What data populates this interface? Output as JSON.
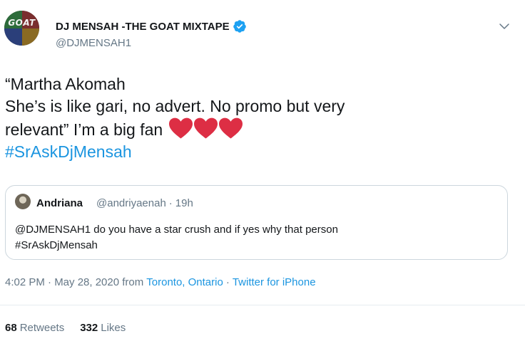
{
  "author": {
    "avatar_text": "GOAT",
    "name": "DJ MENSAH -THE GOAT MIXTAPE",
    "handle": "@DJMENSAH1",
    "verified_icon": "verified-badge-icon"
  },
  "menu_icon": "chevron-down-icon",
  "tweet": {
    "line1": "“Martha Akomah",
    "line2": "She’s is like gari, no advert. No promo but very",
    "line3": "relevant” I’m a big fan",
    "hearts": 3,
    "hashtag": "#SrAskDjMensah"
  },
  "quoted": {
    "name": "Andriana",
    "handle": "@andriyaenah",
    "separator": "·",
    "time": "19h",
    "text_line1": "@DJMENSAH1 do you have a star crush and if yes why that person",
    "text_line2": "#SrAskDjMensah"
  },
  "meta": {
    "time_date": "4:02 PM · May 28, 2020 from",
    "location": "Toronto, Ontario",
    "dot": "·",
    "source": "Twitter for iPhone"
  },
  "stats": {
    "retweets_count": "68",
    "retweets_label": "Retweets",
    "likes_count": "332",
    "likes_label": "Likes"
  },
  "colors": {
    "link": "#1b95e0",
    "muted": "#657786",
    "heart": "#e0245e"
  }
}
